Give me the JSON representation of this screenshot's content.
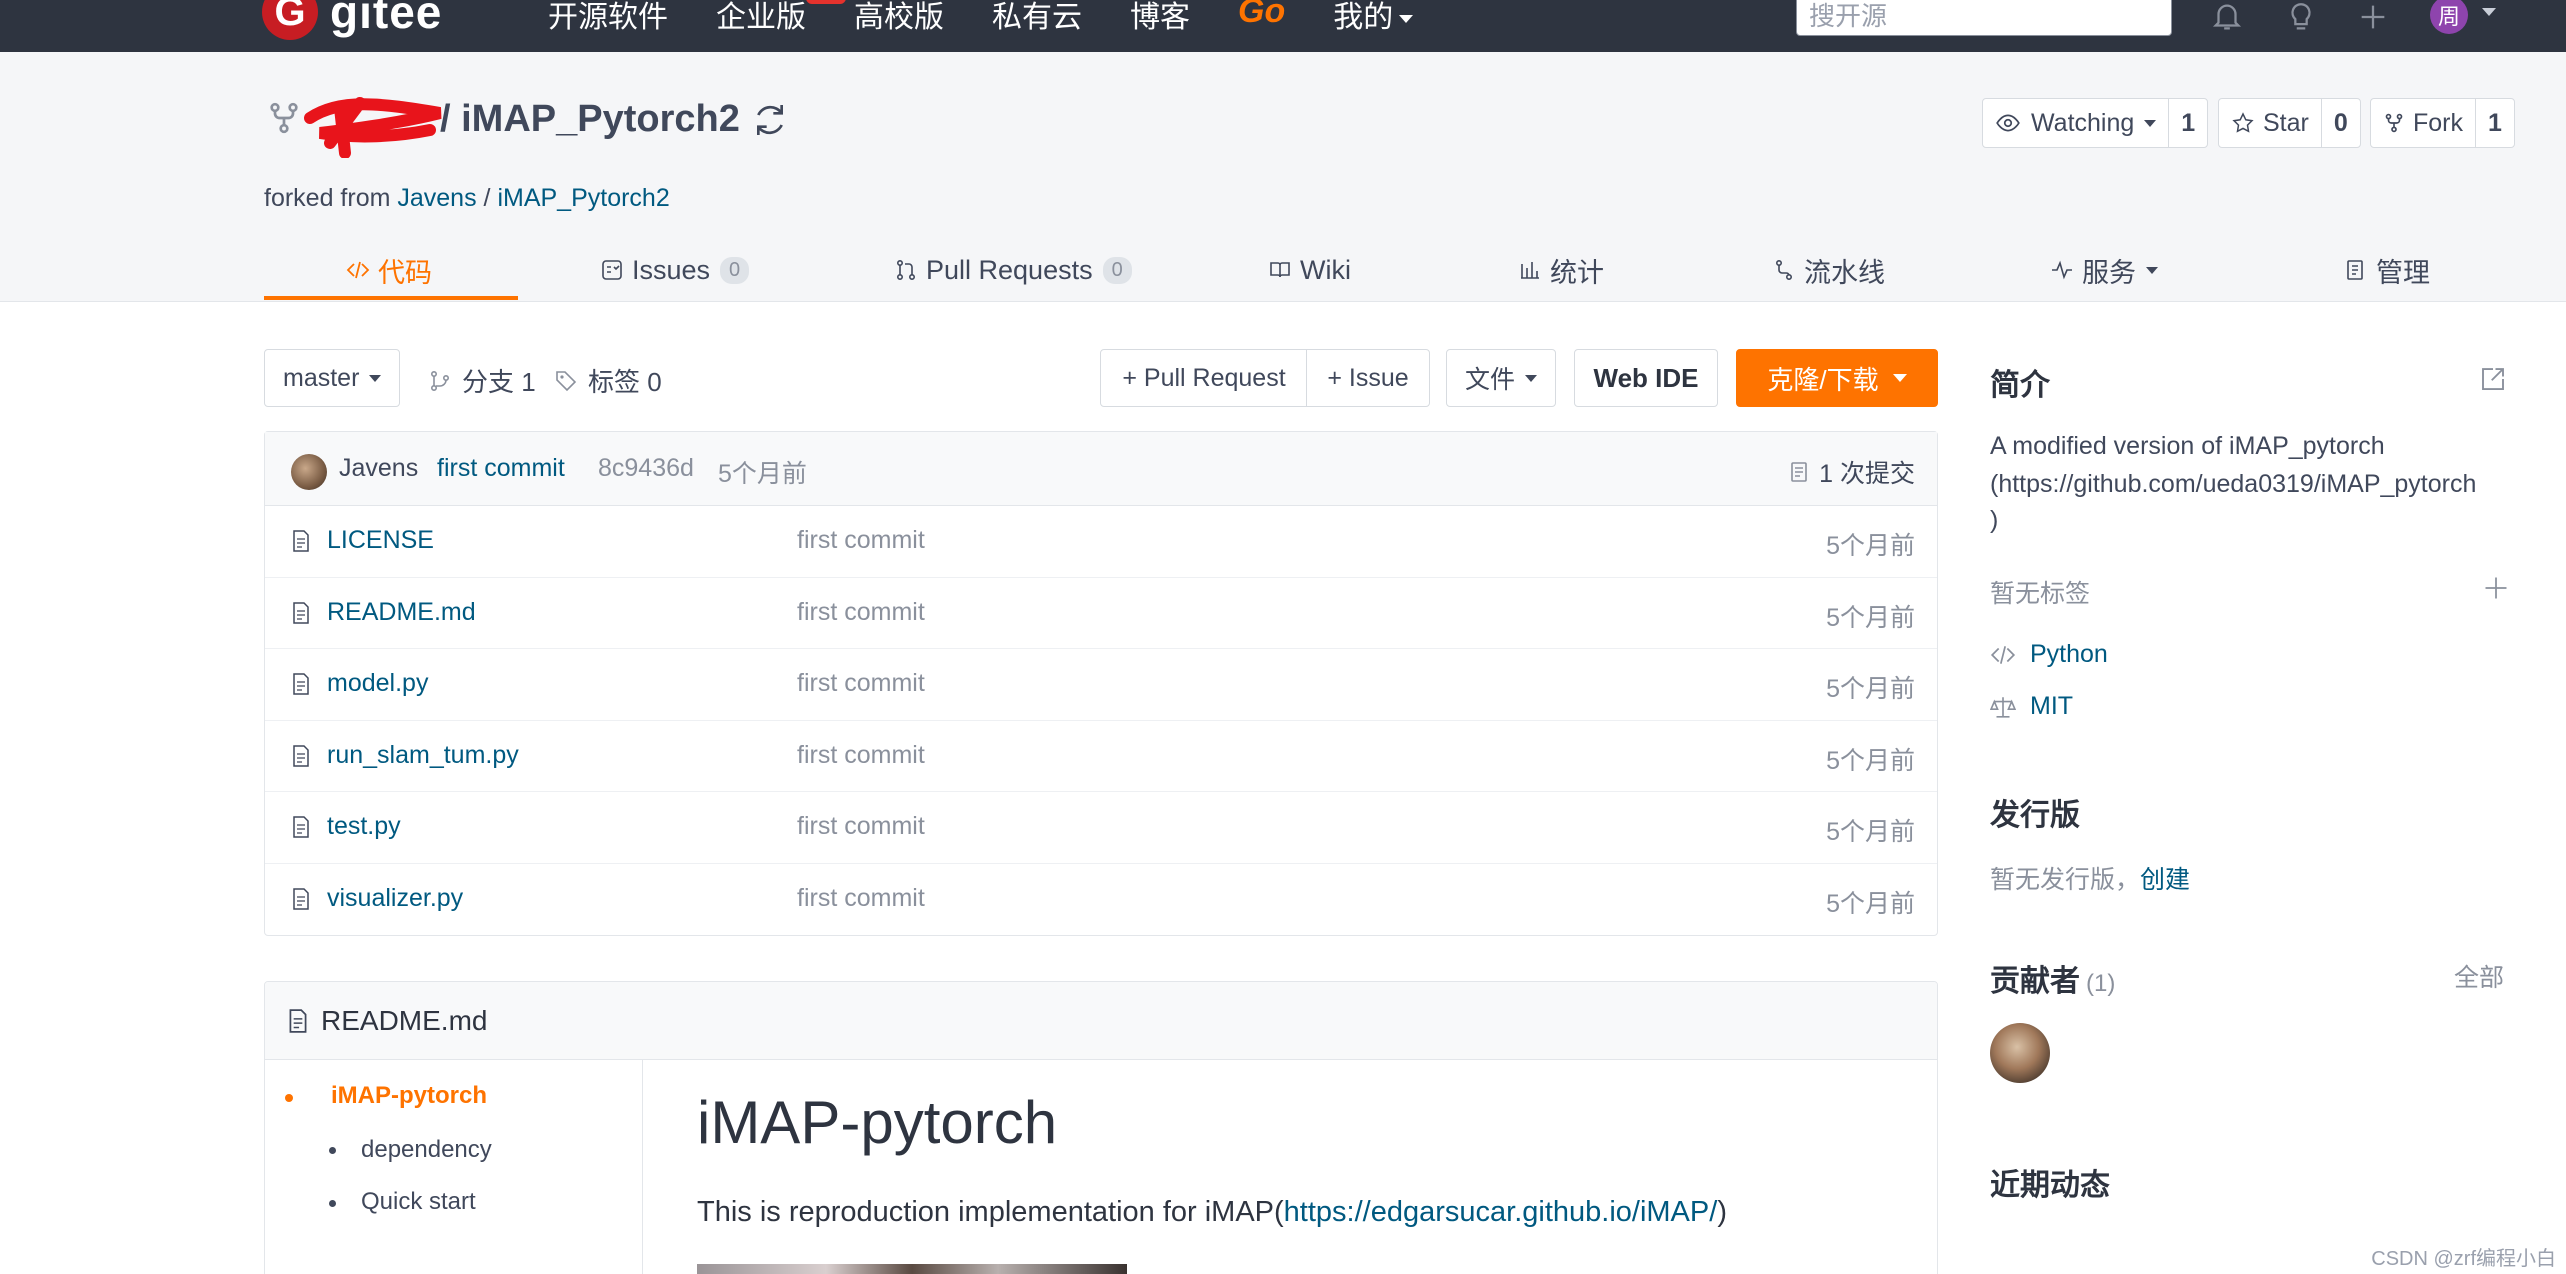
{
  "nav": {
    "logo_text": "gitee",
    "links": [
      "开源软件",
      "企业版",
      "高校版",
      "私有云",
      "博客",
      "Go",
      "我的"
    ],
    "search_placeholder": "搜开源",
    "user_avatar_char": "周"
  },
  "repo": {
    "title": "/ iMAP_Pytorch2",
    "forked_prefix": "forked from ",
    "forked_owner": "Javens",
    "forked_sep": " / ",
    "forked_repo": "iMAP_Pytorch2",
    "watch_label": "Watching",
    "watch_count": "1",
    "star_label": "Star",
    "star_count": "0",
    "fork_label": "Fork",
    "fork_count": "1"
  },
  "tabs": {
    "code": "代码",
    "issues": "Issues",
    "issues_count": "0",
    "pulls": "Pull Requests",
    "pulls_count": "0",
    "wiki": "Wiki",
    "stats": "统计",
    "pipeline": "流水线",
    "services": "服务",
    "admin": "管理"
  },
  "toolbar": {
    "branch": "master",
    "branches": "分支 1",
    "tags": "标签 0",
    "pull_request": "+ Pull Request",
    "issue": "+ Issue",
    "file": "文件",
    "web_ide": "Web IDE",
    "clone": "克隆/下载"
  },
  "commit": {
    "author": "Javens",
    "message": "first commit",
    "hash": "8c9436d",
    "time": "5个月前",
    "count": "1 次提交"
  },
  "files": [
    {
      "name": "LICENSE",
      "message": "first commit",
      "time": "5个月前"
    },
    {
      "name": "README.md",
      "message": "first commit",
      "time": "5个月前"
    },
    {
      "name": "model.py",
      "message": "first commit",
      "time": "5个月前"
    },
    {
      "name": "run_slam_tum.py",
      "message": "first commit",
      "time": "5个月前"
    },
    {
      "name": "test.py",
      "message": "first commit",
      "time": "5个月前"
    },
    {
      "name": "visualizer.py",
      "message": "first commit",
      "time": "5个月前"
    }
  ],
  "readme": {
    "header": "README.md",
    "toc": [
      "iMAP-pytorch",
      "dependency",
      "Quick start"
    ],
    "title": "iMAP-pytorch",
    "text_prefix": "This is reproduction implementation for iMAP(",
    "text_link": "https://edgarsucar.github.io/iMAP/",
    "text_suffix": ")"
  },
  "sidebar": {
    "intro_title": "简介",
    "description_1": "A modified version of iMAP_pytorch",
    "description_2": "(https://github.com/ueda0319/iMAP_pytorch",
    "description_3": ")",
    "no_tags": "暂无标签",
    "language": "Python",
    "license": "MIT",
    "releases_title": "发行版",
    "no_releases": "暂无发行版，",
    "create": "创建",
    "contributors_title": "贡献者",
    "contributors_count": "(1)",
    "all": "全部",
    "activity_title": "近期动态"
  },
  "watermark": "CSDN @zrf编程小白"
}
